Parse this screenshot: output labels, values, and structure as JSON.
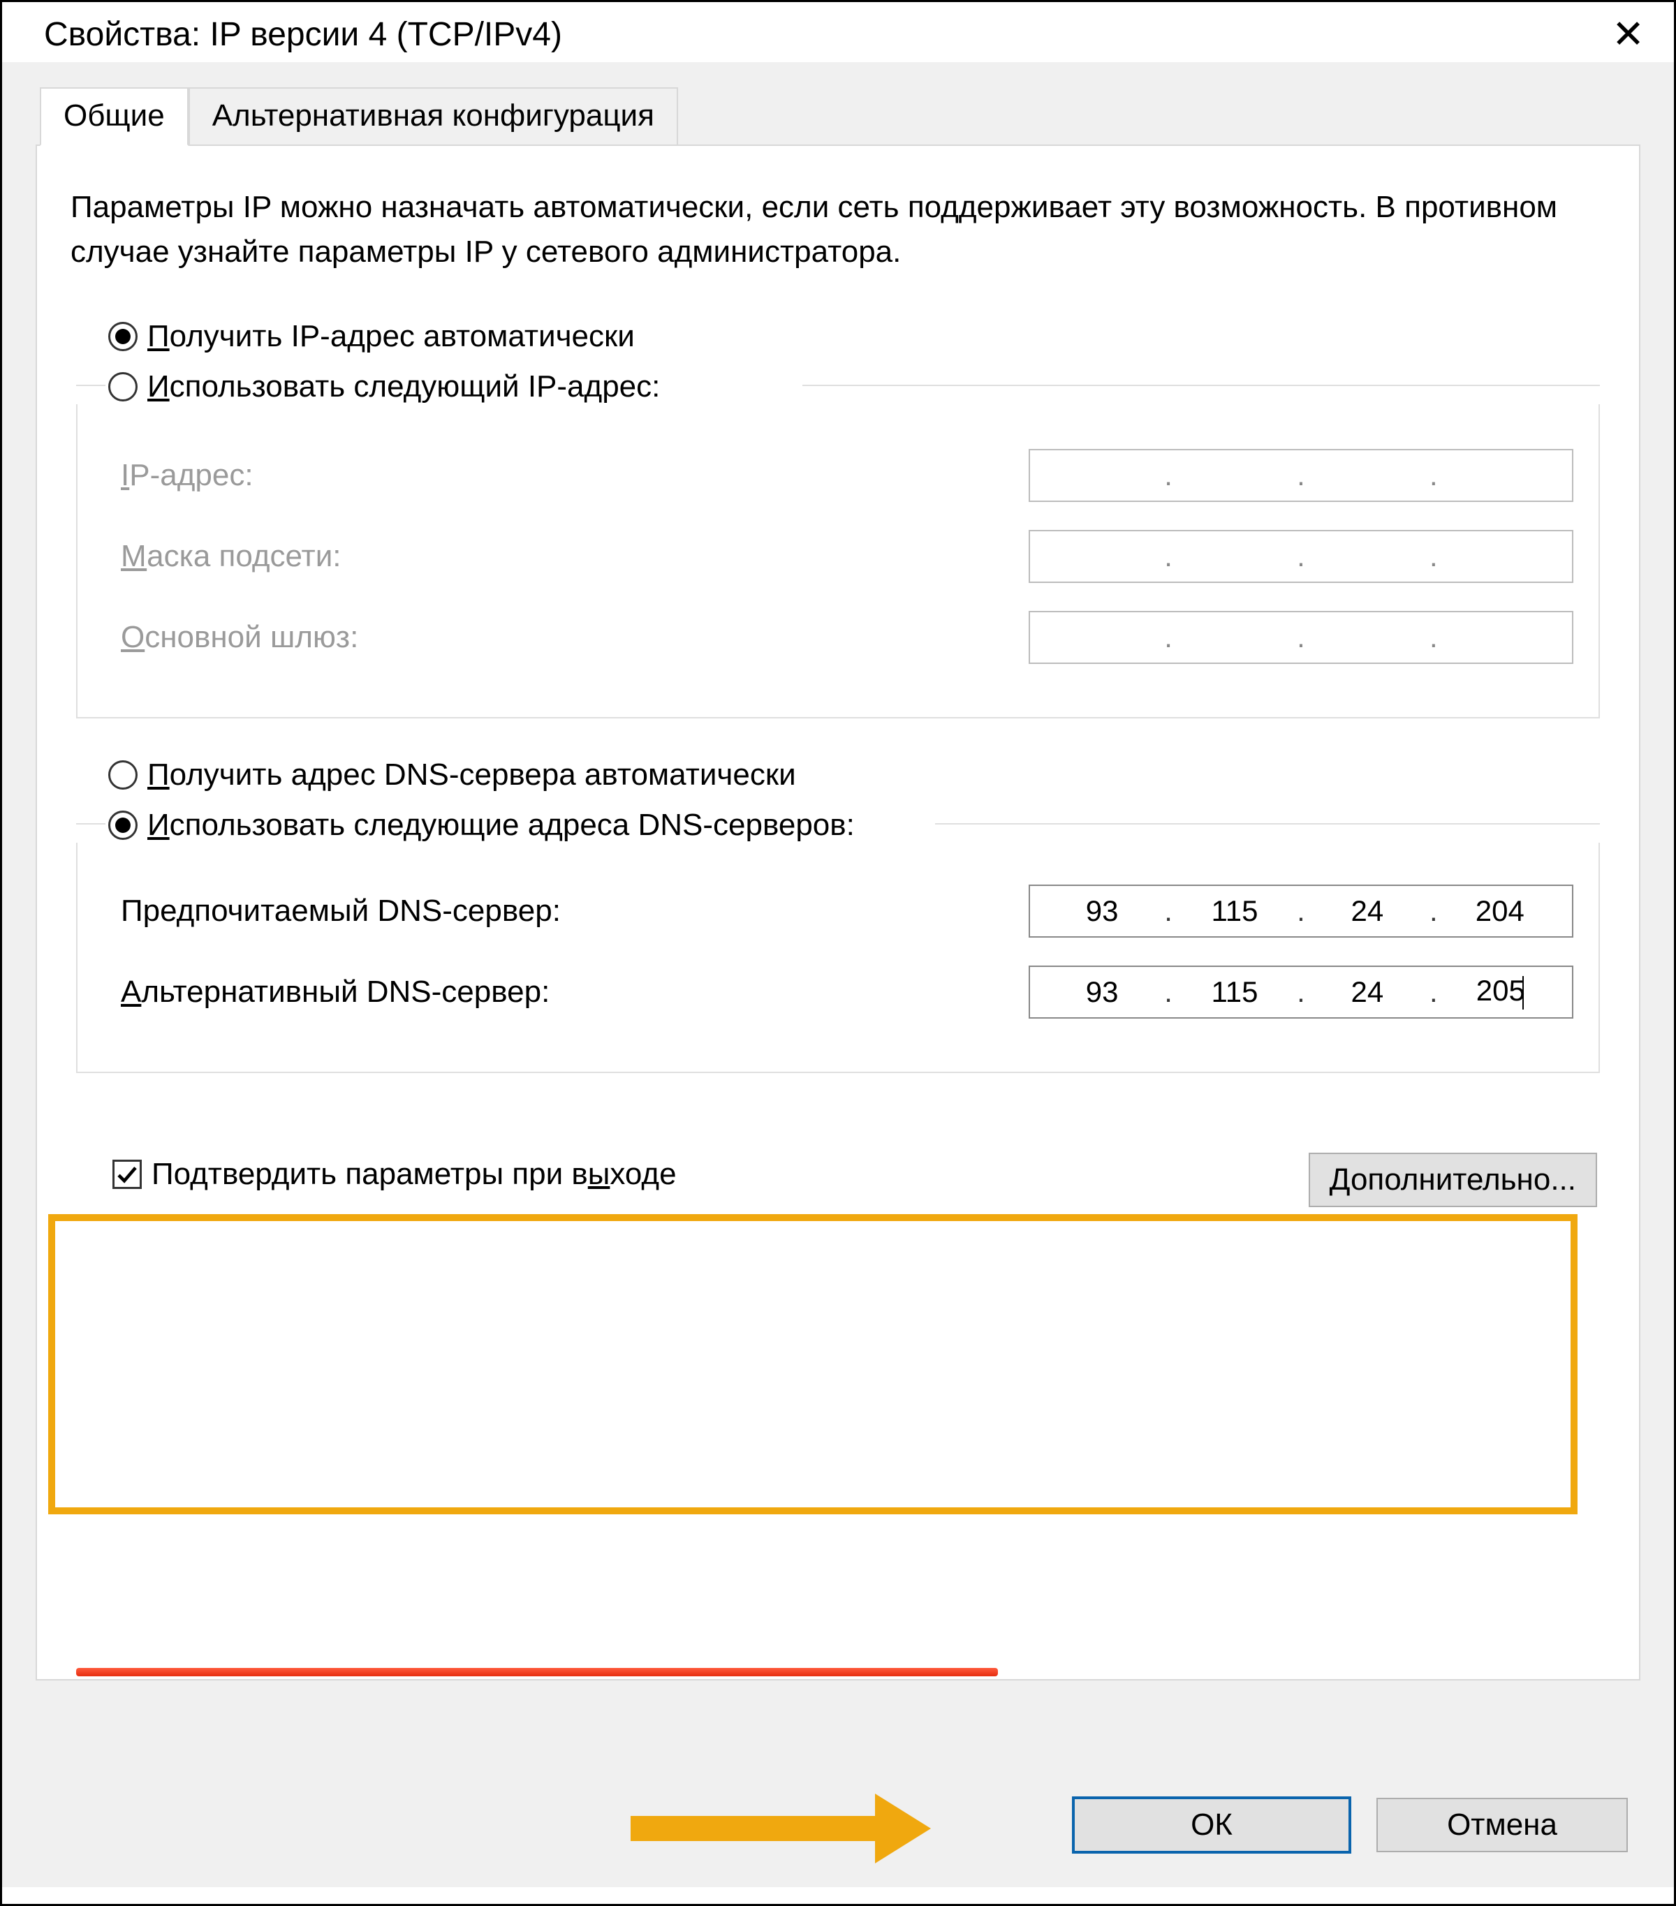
{
  "window": {
    "title": "Свойства: IP версии 4 (TCP/IPv4)"
  },
  "tabs": {
    "general": "Общие",
    "alternate": "Альтернативная конфигурация"
  },
  "description": "Параметры IP можно назначать автоматически, если сеть поддерживает эту возможность. В противном случае узнайте параметры IP у сетевого администратора.",
  "ip_section": {
    "auto_label_pre": "П",
    "auto_label_rest": "олучить IP-адрес автоматически",
    "manual_label_pre": "И",
    "manual_label_rest": "спользовать следующий IP-адрес:",
    "ip_address_label_pre": "I",
    "ip_address_label_rest": "P-адрес:",
    "subnet_label_pre": "М",
    "subnet_label_rest": "аска подсети:",
    "gateway_label_pre": "О",
    "gateway_label_rest": "сновной шлюз:"
  },
  "dns_section": {
    "auto_label_pre": "П",
    "auto_label_rest": "олучить адрес DNS-сервера автоматически",
    "manual_label_pre": "И",
    "manual_label_rest": "спользовать следующие адреса DNS-серверов:",
    "preferred_label": "Предпочитаемый DNS-сервер:",
    "alternate_label_pre": "А",
    "alternate_label_rest": "льтернативный DNS-сервер:",
    "preferred": {
      "a": "93",
      "b": "115",
      "c": "24",
      "d": "204"
    },
    "alternate": {
      "a": "93",
      "b": "115",
      "c": "24",
      "d": "205"
    }
  },
  "validate_checkbox": {
    "label_pre": "Подтвердить параметры при в",
    "label_u": "ы",
    "label_rest": "ходе"
  },
  "buttons": {
    "advanced_pre": "Д",
    "advanced_rest": "ополнительно...",
    "ok": "ОК",
    "cancel": "Отмена"
  }
}
